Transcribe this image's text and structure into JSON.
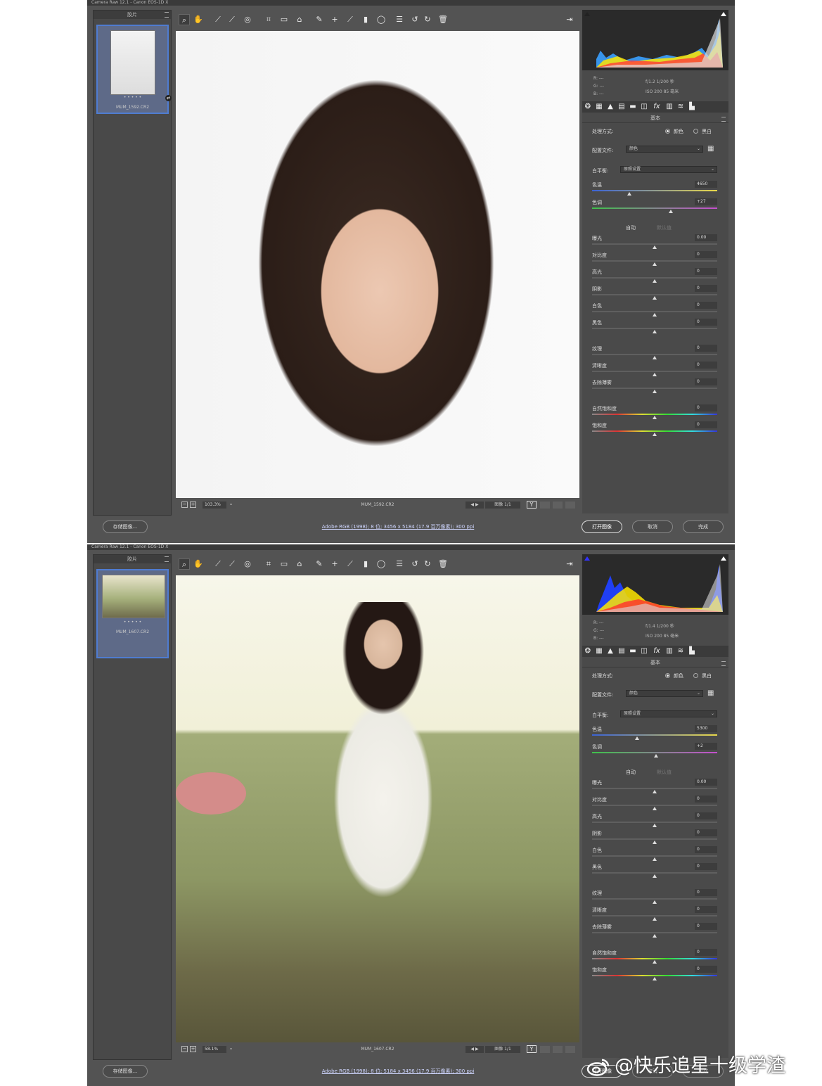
{
  "windows": [
    {
      "title": "Camera Raw 12.1 - Canon EOS-1D X",
      "filmstrip": {
        "title": "胶片",
        "stars": "• • • • •",
        "filename": "MUM_1592.CR2"
      },
      "status": {
        "zoom": "103.3%",
        "filename": "MUM_1592.CR2",
        "image_count": "图像 1/1"
      },
      "bottom": {
        "save": "存储图像...",
        "workflow": "Adobe RGB (1998); 8 位; 3456 x 5184 (17.9 百万像素); 300 ppi",
        "open": "打开图像",
        "cancel": "取消",
        "done": "完成"
      },
      "exif": {
        "r": "R:  ---",
        "g": "G:  ---",
        "b": "B:  ---",
        "line1": "f/1.2   1/200 秒",
        "line2": "ISO 200   85 毫米"
      },
      "panel": {
        "section": "基本",
        "treatment_label": "处理方式:",
        "color": "颜色",
        "bw": "黑白",
        "profile_label": "配置文件:",
        "profile": "颜色",
        "wb_label": "白平衡:",
        "wb": "原照设置",
        "temp_label": "色温",
        "temp": "4650",
        "temp_pos": 0.3,
        "tint_label": "色调",
        "tint": "+27",
        "tint_pos": 0.63,
        "auto": "自动",
        "default": "默认值",
        "sliders": [
          {
            "label": "曝光",
            "value": "0.00"
          },
          {
            "label": "对比度",
            "value": "0"
          },
          {
            "label": "高光",
            "value": "0"
          },
          {
            "label": "阴影",
            "value": "0"
          },
          {
            "label": "白色",
            "value": "0"
          },
          {
            "label": "黑色",
            "value": "0"
          }
        ],
        "sliders2": [
          {
            "label": "纹理",
            "value": "0"
          },
          {
            "label": "清晰度",
            "value": "0"
          },
          {
            "label": "去除薄雾",
            "value": "0"
          }
        ],
        "sliders3": [
          {
            "label": "自然饱和度",
            "value": "0"
          },
          {
            "label": "饱和度",
            "value": "0"
          }
        ]
      }
    },
    {
      "title": "Camera Raw 12.1 - Canon EOS-1D X",
      "filmstrip": {
        "title": "胶片",
        "stars": "• • • • •",
        "filename": "MUM_1607.CR2"
      },
      "status": {
        "zoom": "58.1%",
        "filename": "MUM_1607.CR2",
        "image_count": "图像 1/1"
      },
      "bottom": {
        "save": "存储图像...",
        "workflow": "Adobe RGB (1998); 8 位; 5184 x 3456 (17.9 百万像素); 300 ppi",
        "open": "打开图像",
        "cancel": "取消",
        "done": "完成"
      },
      "exif": {
        "r": "R:  ---",
        "g": "G:  ---",
        "b": "B:  ---",
        "line1": "f/1.4   1/200 秒",
        "line2": "ISO 200   85 毫米"
      },
      "panel": {
        "section": "基本",
        "treatment_label": "处理方式:",
        "color": "颜色",
        "bw": "黑白",
        "profile_label": "配置文件:",
        "profile": "颜色",
        "wb_label": "白平衡:",
        "wb": "原照设置",
        "temp_label": "色温",
        "temp": "5300",
        "temp_pos": 0.36,
        "tint_label": "色调",
        "tint": "+2",
        "tint_pos": 0.51,
        "auto": "自动",
        "default": "默认值",
        "sliders": [
          {
            "label": "曝光",
            "value": "0.00"
          },
          {
            "label": "对比度",
            "value": "0"
          },
          {
            "label": "高光",
            "value": "0"
          },
          {
            "label": "阴影",
            "value": "0"
          },
          {
            "label": "白色",
            "value": "0"
          },
          {
            "label": "黑色",
            "value": "0"
          }
        ],
        "sliders2": [
          {
            "label": "纹理",
            "value": "0"
          },
          {
            "label": "清晰度",
            "value": "0"
          },
          {
            "label": "去除薄雾",
            "value": "0"
          }
        ],
        "sliders3": [
          {
            "label": "自然饱和度",
            "value": "0"
          },
          {
            "label": "饱和度",
            "value": "0"
          }
        ]
      }
    }
  ],
  "toolbar_icons": [
    "zoom-icon",
    "hand-icon",
    "white-balance-icon",
    "color-sampler-icon",
    "target-adjust-icon",
    "crop-icon",
    "straighten-icon",
    "transform-icon",
    "spot-removal-icon",
    "red-eye-icon",
    "adjustment-brush-icon",
    "graduated-filter-icon",
    "radial-filter-icon",
    "presets-icon",
    "rotate-ccw-icon",
    "rotate-cw-icon",
    "trash-icon"
  ],
  "watermark": "@快乐追星十级学渣"
}
